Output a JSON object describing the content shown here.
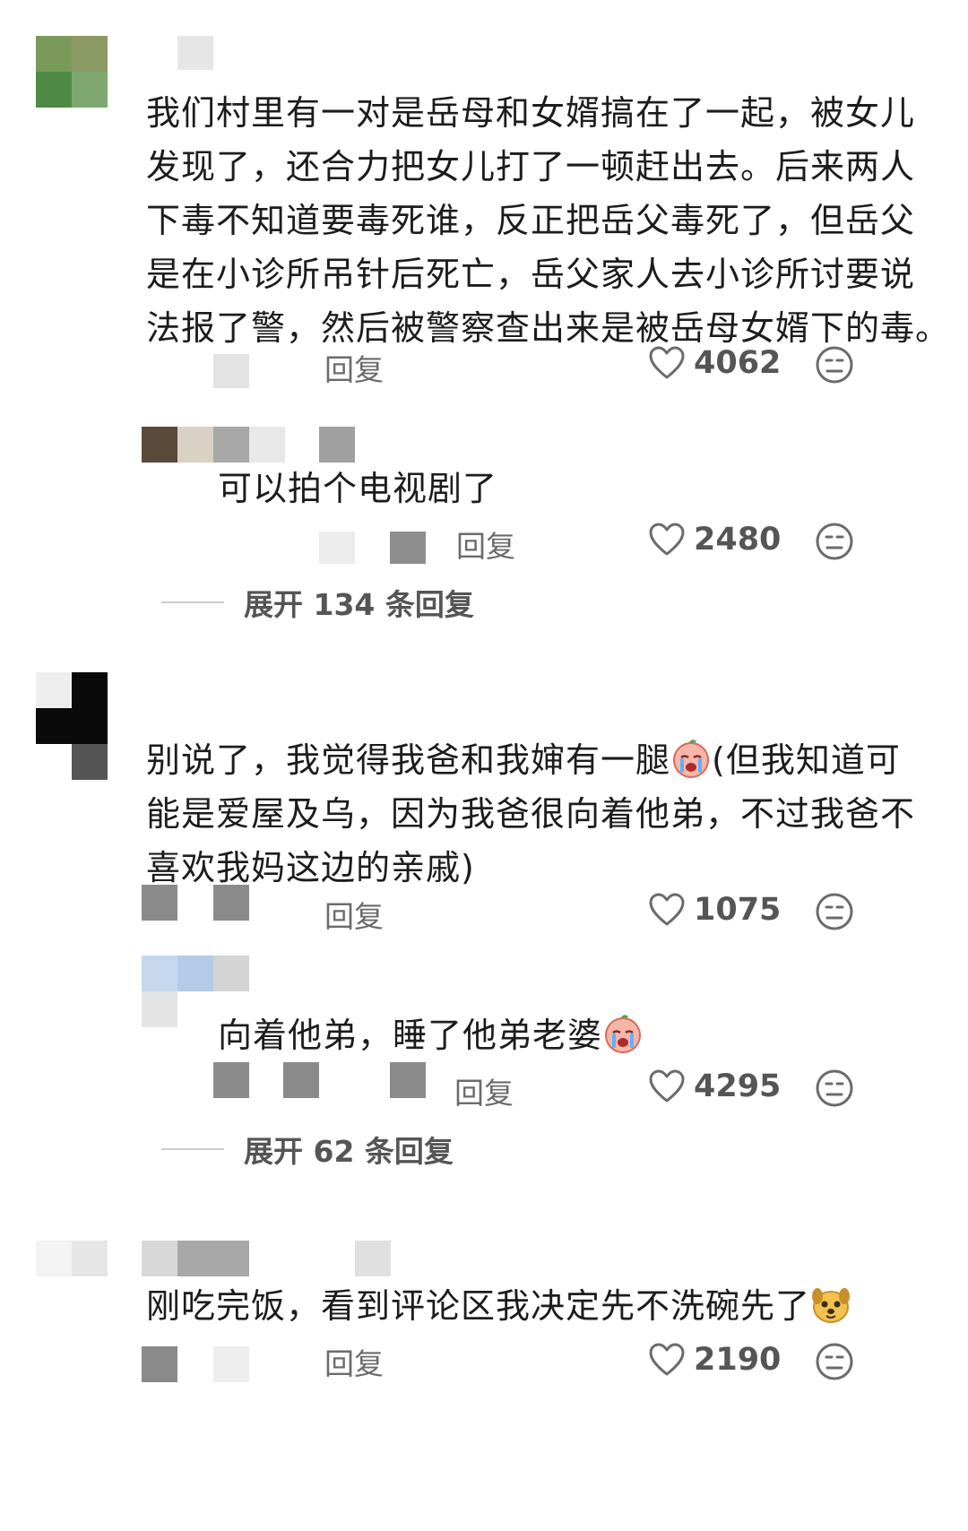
{
  "threads": [
    {
      "comment": "我们村里有一对是岳母和女婿搞在了一起，被女儿发现了，还合力把女儿打了一顿赶出去。后来两人下毒不知道要毒死谁，反正把岳父毒死了，但岳父是在小诊所吊针后死亡，岳父家人去小诊所讨要说法报了警，然后被警察查出来是被岳母女婿下的毒。",
      "comment_lines": [
        "我们村里有一对是岳母和女婿搞在了一起，被女儿",
        "发现了，还合力把女儿打了一顿赶出去。后来两人",
        "下毒不知道要毒死谁，反正把岳父毒死了，但岳父",
        "是在小诊所吊针后死亡，岳父家人去小诊所讨要说",
        "法报了警，然后被警察查出来是被岳母女婿下的毒。"
      ],
      "reply_label": "回复",
      "likes": "4062",
      "sub_reply": {
        "text": "可以拍个电视剧了",
        "reply_label": "回复",
        "likes": "2480"
      },
      "expand_label": "展开 134 条回复"
    },
    {
      "comment_lines": [
        "别说了，我觉得我爸和我婶有一腿",
        "(但我知道可",
        "能是爱屋及乌，因为我爸很向着他弟，不过我爸不",
        "喜欢我妈这边的亲戚)"
      ],
      "reply_label": "回复",
      "likes": "1075",
      "sub_reply": {
        "text": "向着他弟，睡了他弟老婆",
        "reply_label": "回复",
        "likes": "4295"
      },
      "expand_label": "展开 62 条回复"
    },
    {
      "comment": "刚吃完饭，看到评论区我决定先不洗碗先了",
      "reply_label": "回复",
      "likes": "2190"
    }
  ],
  "icons": {
    "like": "heart-outline-icon",
    "dislike": "neutral-face-icon",
    "emoji_cry": "crying-face-emoji",
    "emoji_dog": "dog-face-emoji"
  },
  "colors": {
    "text": "#1c1c1c",
    "meta": "#6b6b6b",
    "mosaic_gray": "#8c8c8c"
  }
}
